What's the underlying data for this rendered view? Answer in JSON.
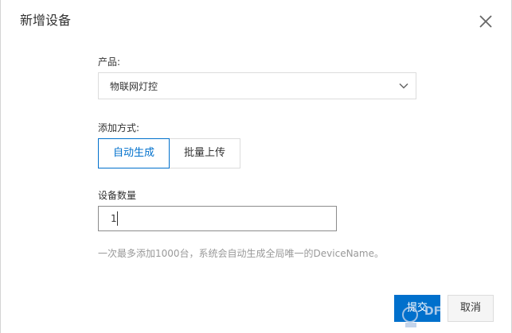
{
  "dialog": {
    "title": "新增设备",
    "close_icon": "close-icon"
  },
  "product": {
    "label": "产品:",
    "selected": "物联网灯控",
    "arrow_icon": "chevron-down-icon"
  },
  "add_method": {
    "label": "添加方式:",
    "options": [
      {
        "label": "自动生成",
        "selected": true
      },
      {
        "label": "批量上传",
        "selected": false
      }
    ]
  },
  "device_count": {
    "label": "设备数量",
    "value": "1"
  },
  "hint": "一次最多添加1000台，系统会自动生成全局唯一的DeviceName。",
  "footer": {
    "confirm_label": "提交",
    "cancel_label": "取消"
  },
  "colors": {
    "accent": "#0070cc",
    "border": "#dcdcdc",
    "hint_text": "#999999"
  }
}
